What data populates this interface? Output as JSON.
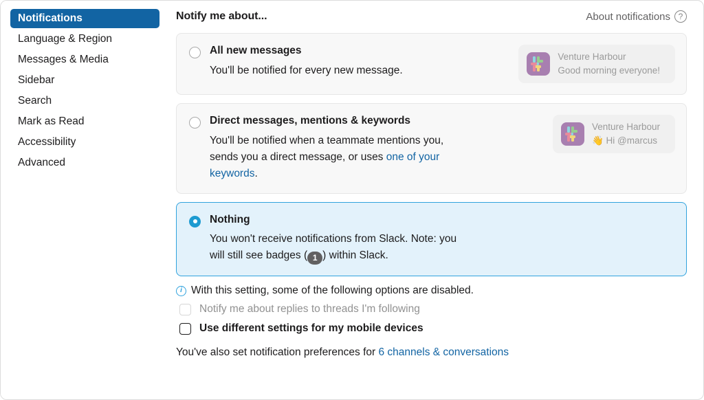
{
  "sidebar": {
    "items": [
      {
        "label": "Notifications",
        "active": true
      },
      {
        "label": "Language & Region",
        "active": false
      },
      {
        "label": "Messages & Media",
        "active": false
      },
      {
        "label": "Sidebar",
        "active": false
      },
      {
        "label": "Search",
        "active": false
      },
      {
        "label": "Mark as Read",
        "active": false
      },
      {
        "label": "Accessibility",
        "active": false
      },
      {
        "label": "Advanced",
        "active": false
      }
    ]
  },
  "header": {
    "title": "Notify me about...",
    "about_link": "About notifications",
    "help_icon": "question-mark-icon"
  },
  "options": [
    {
      "title": "All new messages",
      "description": "You'll be notified for every new message.",
      "selected": false,
      "preview": {
        "app_name": "Venture Harbour",
        "message": "Good morning everyone!",
        "icon": "slack-app-icon"
      }
    },
    {
      "title": "Direct messages, mentions & keywords",
      "description_part1": "You'll be notified when a teammate mentions you, sends you a direct message, or uses ",
      "description_link": "one of your keywords",
      "description_part2": ".",
      "selected": false,
      "preview": {
        "app_name": "Venture Harbour",
        "message": "👋 Hi @marcus",
        "icon": "slack-app-icon"
      }
    },
    {
      "title": "Nothing",
      "description_part1": "You won't receive notifications from Slack. Note: you will still see badges (",
      "badge": "1",
      "description_part2": ") within Slack.",
      "selected": true
    }
  ],
  "footer": {
    "info_note": "With this setting, some of the following options are disabled.",
    "checkboxes": [
      {
        "label": "Notify me about replies to threads I'm following",
        "checked": false,
        "disabled": true
      },
      {
        "label": "Use different settings for my mobile devices",
        "checked": false,
        "disabled": false
      }
    ],
    "prefs_text": "You've also set notification preferences for ",
    "prefs_link": "6 channels & conversations"
  },
  "colors": {
    "accent_blue": "#1264a3",
    "radio_blue": "#1d9bd1",
    "selected_card_bg": "#e3f2fb",
    "selected_card_border": "#2fa2dd",
    "badge_grey": "#616061",
    "app_icon_purple": "#a87fb0"
  }
}
